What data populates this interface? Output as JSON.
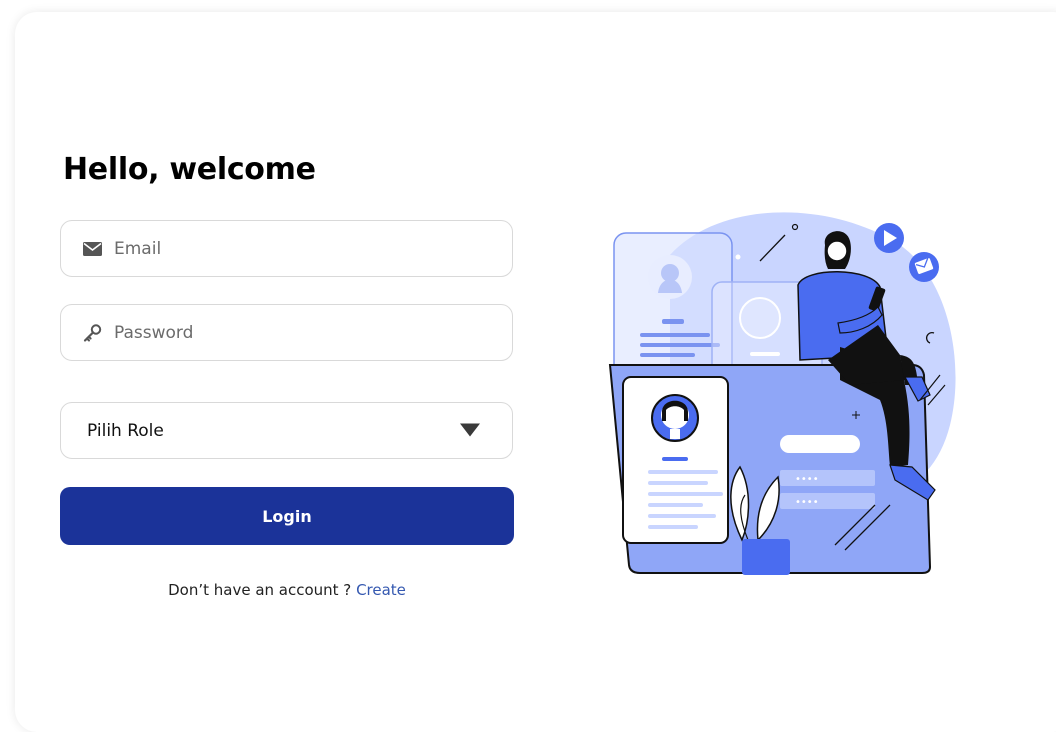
{
  "login": {
    "title": "Hello, welcome",
    "email_placeholder": "Email",
    "password_placeholder": "Password",
    "role_select": "Pilih Role",
    "login_button": "Login",
    "signup_prompt": "Don’t have an account ?",
    "signup_link": "Create"
  },
  "illustration": {
    "password_mask_1": "••••",
    "password_mask_2": "••••"
  },
  "icons": {
    "email": "envelope-icon",
    "password": "key-icon",
    "select": "triangle-down-icon"
  },
  "colors": {
    "primary": "#1b3399",
    "link": "#3458b0",
    "illustration_blue": "#8fa6f7",
    "illustration_light": "#c9d5ff",
    "accent_blue": "#4a6cf0"
  }
}
